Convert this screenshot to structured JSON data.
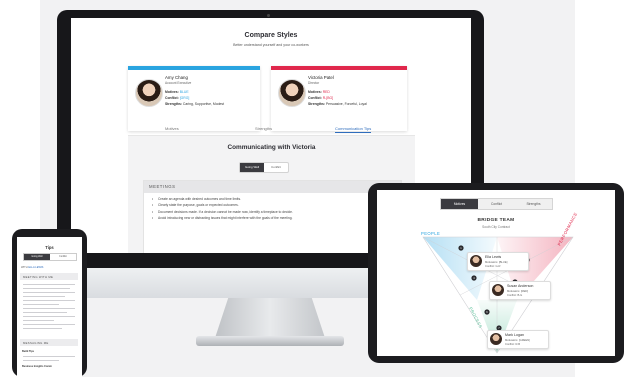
{
  "imac": {
    "title": "Compare Styles",
    "subtitle": "Better understand yourself and your co-workers",
    "cards": [
      {
        "name": "Amy Chang",
        "role": "Account Executive",
        "motives_label": "Motives:",
        "motives_value": "BLUE",
        "conflict_label": "Conflict:",
        "conflict_value": "[GRG]",
        "strengths_label": "Strengths:",
        "strengths_value": "Caring, Supportive, Modest",
        "bar_color": "#2aa4e0"
      },
      {
        "name": "Victoria Patel",
        "role": "Director",
        "motives_label": "Motives:",
        "motives_value": "RED",
        "conflict_label": "Conflict:",
        "conflict_value": "R-[BG]",
        "strengths_label": "Strengths:",
        "strengths_value": "Persuasive, Forceful, Loyal",
        "bar_color": "#e0284c"
      }
    ],
    "tabs": [
      "Motives",
      "Strengths",
      "Communication Tips"
    ],
    "active_tab": "Communication Tips",
    "comm_title": "Communicating with Victoria",
    "toggle": [
      "Going Well",
      "Conflict"
    ],
    "meetings_header": "MEETINGS",
    "meetings_items": [
      "Create an agenda with desired outcomes and time limits.",
      "Clearly state the purpose, goals or expected outcomes.",
      "Document decisions made. If a decision cannot be made now, identify a timeplace to decide.",
      "Avoid introducing new or distracting issues that might interfere with the goals of the meeting."
    ]
  },
  "ipad": {
    "tabs": [
      "Motives",
      "Conflict",
      "Strengths"
    ],
    "team_title": "BRIDGE TEAM",
    "team_subtitle": "South City Contract",
    "label_people": "PEOPLE",
    "label_performance": "PERFORMANCE",
    "label_process": "PROCESS",
    "markers": [
      "1",
      "2",
      "3",
      "4",
      "5",
      "6",
      "7"
    ],
    "people": [
      {
        "name": "Ella Lewis",
        "motive": "Motivators: [BLUE]",
        "conflict": "Conflict: G-R"
      },
      {
        "name": "Susan Anderson",
        "motive": "Motivators: [RED]",
        "conflict": "Conflict: B-G"
      },
      {
        "name": "Mark Logan",
        "motive": "Motivators: [GREEN]",
        "conflict": "Conflict: R-B"
      }
    ],
    "colors": {
      "people": "#2aa4e0",
      "performance": "#e0284c",
      "process": "#5cc19a"
    }
  },
  "phone": {
    "title": "Tips",
    "toggle": [
      "Going Well",
      "Conflict"
    ],
    "with_label": "WITH",
    "with_name": "ELLA LEWIS",
    "section1": "MEETING WITH ME",
    "section2": "MESSAGING ME",
    "text1": "Build Tips",
    "text2": "Business Insights Comm"
  }
}
